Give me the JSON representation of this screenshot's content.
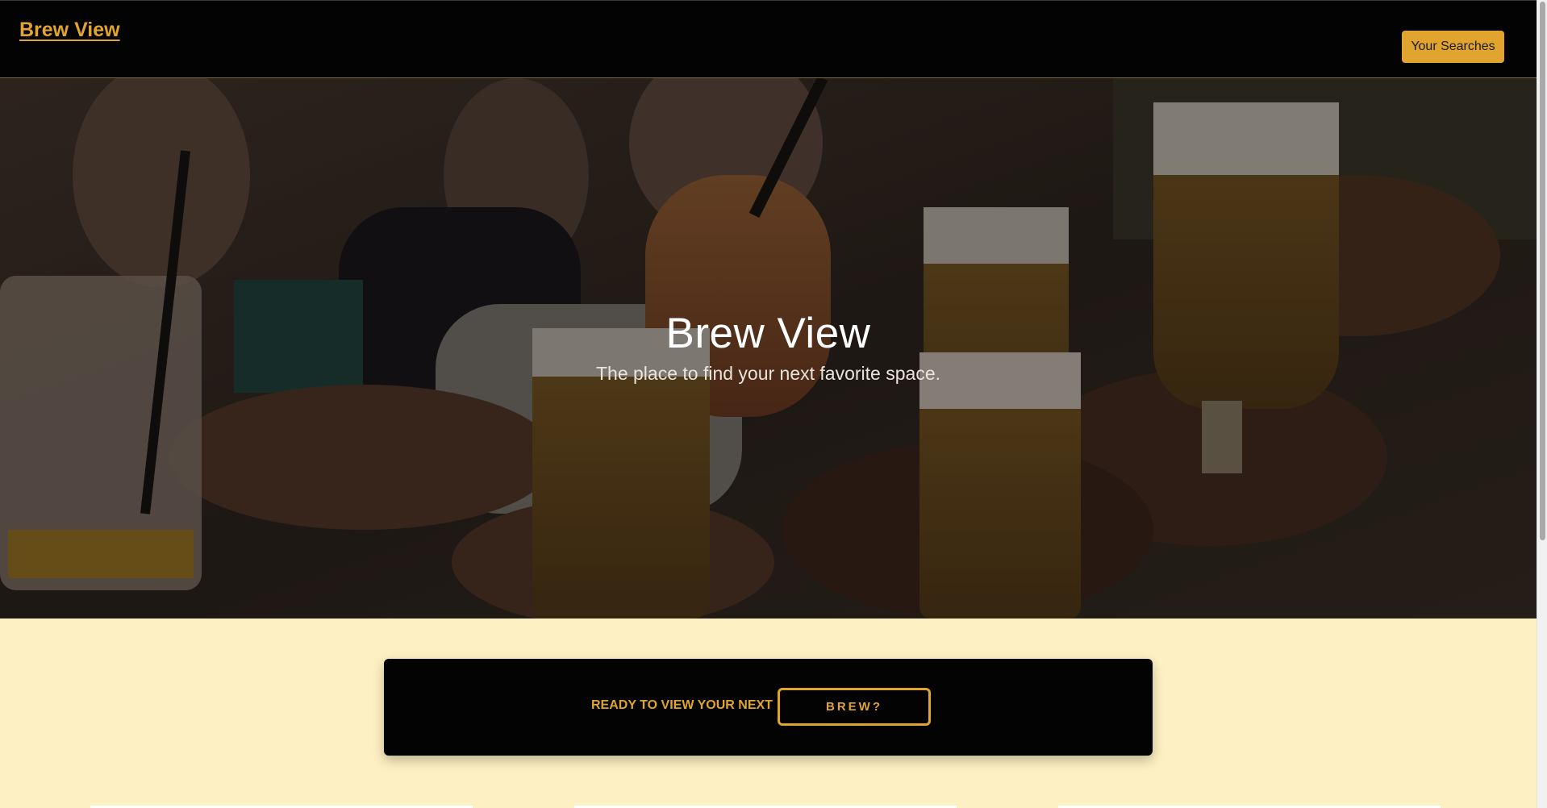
{
  "navbar": {
    "brand": "Brew View",
    "searches_button": "Your Searches"
  },
  "hero": {
    "title": "Brew View",
    "subtitle": "The place to find your next favorite space."
  },
  "cta": {
    "label": "READY TO VIEW YOUR NEXT",
    "button": "BREW?"
  },
  "colors": {
    "accent": "#e0a42f",
    "navbar": "#030303",
    "page_background": "#fdf0c2"
  }
}
